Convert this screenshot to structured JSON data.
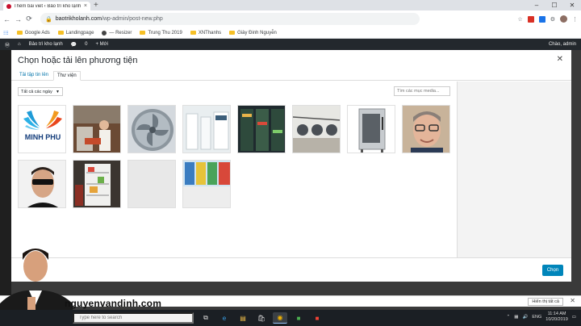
{
  "browser": {
    "tab_title": "Thêm bài viết ‹ Bảo trì kho lạnh",
    "url_domain": "baotrikholanh.com",
    "url_path": "/wp-admin/post-new.php",
    "bookmarks": [
      "Google Ads",
      "Landingpage",
      "— Resizer",
      "Trung Thu 2019",
      "XNThanhs",
      "Giày Đinh Nguyễn"
    ]
  },
  "wpbar": {
    "site": "Bảo trì kho lạnh",
    "comments": "0",
    "new": "+ Mới",
    "greeting": "Chào, admin"
  },
  "modal": {
    "title": "Chọn hoặc tải lên phương tiện",
    "tab_upload": "Tải tập tin lên",
    "tab_library": "Thư viện",
    "date_filter": "Tất cả các ngày",
    "search_placeholder": "Tìm các mục media...",
    "select_button": "Chọn"
  },
  "logo_text": "MINH PHU",
  "notification": {
    "show_all": "Hiển thị tất cả"
  },
  "brand": "nguyenvandinh.com",
  "taskbar": {
    "search_placeholder": "Type here to search",
    "lang": "ENG",
    "time": "11:14 AM",
    "date": "10/20/2019"
  },
  "colors": {
    "accent": "#0085ba",
    "admin_bar": "#23282d"
  }
}
